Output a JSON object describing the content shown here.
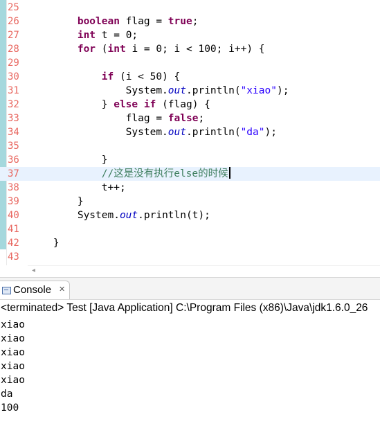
{
  "editor": {
    "lines": [
      {
        "num": "25",
        "segments": []
      },
      {
        "num": "26",
        "segments": [
          {
            "t": "        ",
            "c": "p"
          },
          {
            "t": "boolean",
            "c": "kw"
          },
          {
            "t": " flag = ",
            "c": "p"
          },
          {
            "t": "true",
            "c": "kw"
          },
          {
            "t": ";",
            "c": "p"
          }
        ]
      },
      {
        "num": "27",
        "segments": [
          {
            "t": "        ",
            "c": "p"
          },
          {
            "t": "int",
            "c": "kw"
          },
          {
            "t": " t = 0;",
            "c": "p"
          }
        ]
      },
      {
        "num": "28",
        "segments": [
          {
            "t": "        ",
            "c": "p"
          },
          {
            "t": "for",
            "c": "kw"
          },
          {
            "t": " (",
            "c": "p"
          },
          {
            "t": "int",
            "c": "kw"
          },
          {
            "t": " i = 0; i < 100; i++) {",
            "c": "p"
          }
        ]
      },
      {
        "num": "29",
        "segments": []
      },
      {
        "num": "30",
        "segments": [
          {
            "t": "            ",
            "c": "p"
          },
          {
            "t": "if",
            "c": "kw"
          },
          {
            "t": " (i < 50) {",
            "c": "p"
          }
        ]
      },
      {
        "num": "31",
        "segments": [
          {
            "t": "                System.",
            "c": "p"
          },
          {
            "t": "out",
            "c": "fld"
          },
          {
            "t": ".println(",
            "c": "p"
          },
          {
            "t": "\"xiao\"",
            "c": "str"
          },
          {
            "t": ");",
            "c": "p"
          }
        ]
      },
      {
        "num": "32",
        "segments": [
          {
            "t": "            } ",
            "c": "p"
          },
          {
            "t": "else",
            "c": "kw"
          },
          {
            "t": " ",
            "c": "p"
          },
          {
            "t": "if",
            "c": "kw"
          },
          {
            "t": " (flag) {",
            "c": "p"
          }
        ]
      },
      {
        "num": "33",
        "segments": [
          {
            "t": "                flag = ",
            "c": "p"
          },
          {
            "t": "false",
            "c": "kw"
          },
          {
            "t": ";",
            "c": "p"
          }
        ]
      },
      {
        "num": "34",
        "segments": [
          {
            "t": "                System.",
            "c": "p"
          },
          {
            "t": "out",
            "c": "fld"
          },
          {
            "t": ".println(",
            "c": "p"
          },
          {
            "t": "\"da\"",
            "c": "str"
          },
          {
            "t": ");",
            "c": "p"
          }
        ]
      },
      {
        "num": "35",
        "segments": []
      },
      {
        "num": "36",
        "segments": [
          {
            "t": "            }",
            "c": "p"
          }
        ]
      },
      {
        "num": "37",
        "current": true,
        "segments": [
          {
            "t": "            ",
            "c": "p"
          },
          {
            "t": "//这是没有执行else的时候",
            "c": "cmt"
          }
        ]
      },
      {
        "num": "38",
        "segments": [
          {
            "t": "            t++;",
            "c": "p"
          }
        ]
      },
      {
        "num": "39",
        "segments": [
          {
            "t": "        }",
            "c": "p"
          }
        ]
      },
      {
        "num": "40",
        "segments": [
          {
            "t": "        System.",
            "c": "p"
          },
          {
            "t": "out",
            "c": "fld"
          },
          {
            "t": ".println(t);",
            "c": "p"
          }
        ]
      },
      {
        "num": "41",
        "segments": []
      },
      {
        "num": "42",
        "segments": [
          {
            "t": "    }",
            "c": "p"
          }
        ]
      },
      {
        "num": "43",
        "segments": []
      }
    ]
  },
  "scrollbar": {
    "left_arrow": "◂"
  },
  "console": {
    "tab_label": "Console",
    "close_icon": "✕",
    "status": "<terminated> Test [Java Application] C:\\Program Files (x86)\\Java\\jdk1.6.0_26",
    "output": [
      "xiao",
      "xiao",
      "xiao",
      "xiao",
      "xiao",
      "da",
      "100"
    ]
  }
}
